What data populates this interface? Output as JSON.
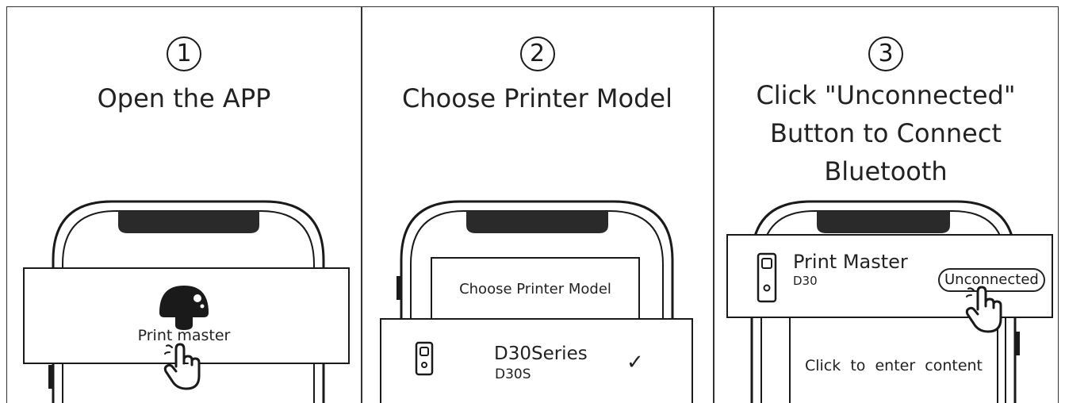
{
  "steps": [
    {
      "number": "1",
      "title": "Open the APP",
      "app_label": "Print master"
    },
    {
      "number": "2",
      "title": "Choose Printer Model",
      "screen_text": "Choose Printer Model",
      "model_name": "D30Series",
      "model_sub": "D30S",
      "check": "✓"
    },
    {
      "number": "3",
      "title": "Click \"Unconnected\"\nButton to Connect\nBluetooth",
      "app_name": "Print  Master",
      "device": "D30",
      "status_button": "Unconnected",
      "content_text": "Click  to  enter  content"
    }
  ]
}
